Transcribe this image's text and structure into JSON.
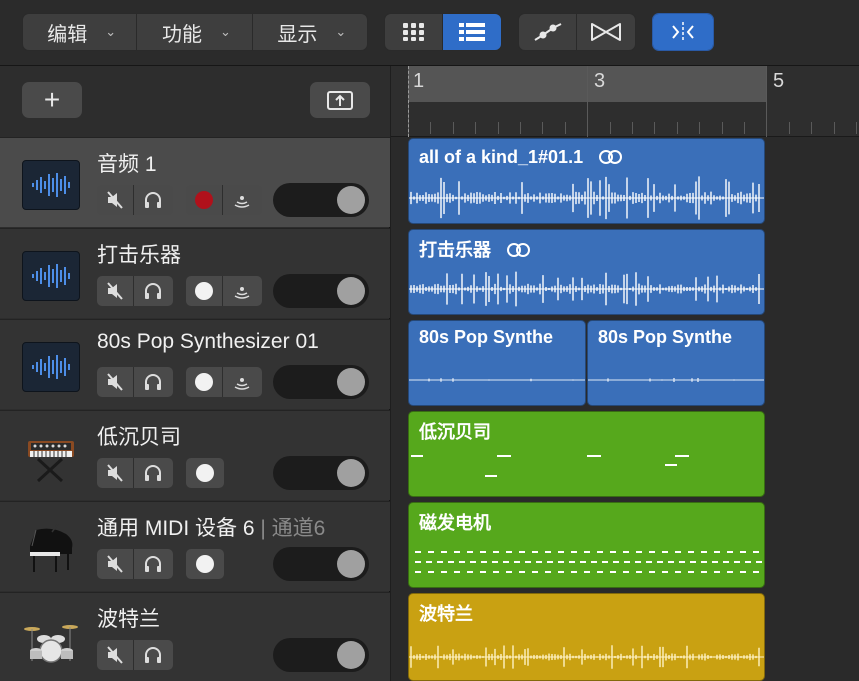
{
  "toolbar": {
    "menus": [
      {
        "label": "编辑",
        "chevron": "⌄"
      },
      {
        "label": "功能",
        "chevron": "⌄"
      },
      {
        "label": "显示",
        "chevron": "⌄"
      }
    ],
    "view_buttons": [
      "grid-view-icon",
      "list-view-icon"
    ],
    "edit_buttons": [
      "automation-curve-icon",
      "flex-time-icon"
    ],
    "snap_button": "catch-playhead-icon",
    "accent_color": "#2f6dc8"
  },
  "header_controls": {
    "add_label": "+",
    "upload_icon": "upload-icon"
  },
  "tracks": [
    {
      "name": "音频 1",
      "sub": "",
      "icon": "waveform-icon",
      "rec_armed": true,
      "has_input_monitor": true
    },
    {
      "name": "打击乐器",
      "sub": "",
      "icon": "waveform-icon",
      "rec_armed": false,
      "has_input_monitor": true
    },
    {
      "name": "80s Pop Synthesizer 01",
      "sub": "",
      "icon": "waveform-icon",
      "rec_armed": false,
      "has_input_monitor": true
    },
    {
      "name": "低沉贝司",
      "sub": "",
      "icon": "synthesizer-icon",
      "rec_armed": false,
      "has_input_monitor": false
    },
    {
      "name": "通用 MIDI 设备 6",
      "sub": " | 通道6",
      "icon": "grand-piano-icon",
      "rec_armed": false,
      "has_input_monitor": false
    },
    {
      "name": "波特兰",
      "sub": "",
      "icon": "drum-kit-icon",
      "rec_armed": false,
      "has_input_monitor": false,
      "no_record": true
    }
  ],
  "ruler": {
    "bars": [
      "1",
      "3",
      "5"
    ]
  },
  "regions": [
    {
      "name": "all of a kind_1#01.1",
      "color": "#3a6fb9",
      "loop_icon": true
    },
    {
      "name": "打击乐器",
      "color": "#3a6fb9",
      "loop_icon": true
    },
    {
      "name": "80s Pop Synthe",
      "color": "#3a6fb9",
      "loop_icon": false
    },
    {
      "name": "80s Pop Synthe",
      "color": "#3a6fb9",
      "loop_icon": false
    },
    {
      "name": "低沉贝司",
      "color": "#56a81c",
      "loop_icon": false
    },
    {
      "name": "磁发电机",
      "color": "#56a81c",
      "loop_icon": false
    },
    {
      "name": "波特兰",
      "color": "#c9a112",
      "loop_icon": false
    }
  ]
}
